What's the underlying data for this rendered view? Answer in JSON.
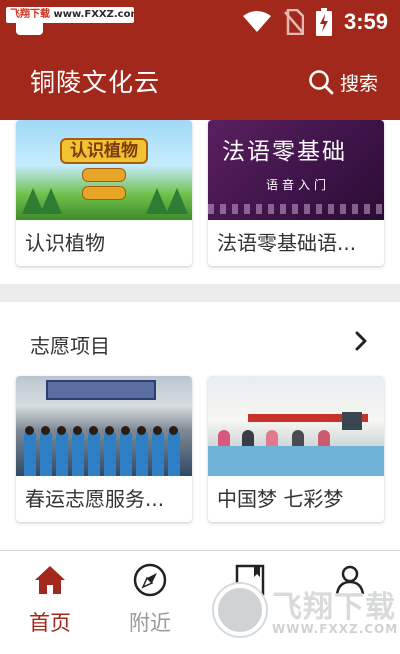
{
  "status_bar": {
    "time": "3:59",
    "icons": [
      "wifi-icon",
      "no-sim-icon",
      "battery-charging-icon"
    ],
    "watermark": {
      "brand": "飞翔下载",
      "url": "www.FXXZ.com"
    }
  },
  "app_bar": {
    "title": "铜陵文化云",
    "search_label": "搜索",
    "search_icon": "search-icon"
  },
  "courses": [
    {
      "label": "认识植物",
      "image_text": "认识植物"
    },
    {
      "label": "法语零基础语...",
      "image_text": "法语零基础",
      "image_subtext": "语音入门"
    }
  ],
  "volunteer_section": {
    "title": "志愿项目",
    "more_icon": "chevron-right-icon",
    "items": [
      {
        "label": "春运志愿服务..."
      },
      {
        "label": "中国梦 七彩梦"
      }
    ]
  },
  "bottom_nav": [
    {
      "label": "首页",
      "icon": "home-icon",
      "active": true
    },
    {
      "label": "附近",
      "icon": "compass-icon",
      "active": false
    },
    {
      "label": "",
      "icon": "book-icon",
      "active": false
    },
    {
      "label": "",
      "icon": "user-icon",
      "active": false
    }
  ],
  "watermark_logo": {
    "brand": "飞翔下载",
    "url": "WWW.FXXZ.COM"
  },
  "colors": {
    "brand": "#a1281a",
    "page_background": "#ececec",
    "text": "#333333",
    "nav_inactive": "#9a9a9a"
  }
}
